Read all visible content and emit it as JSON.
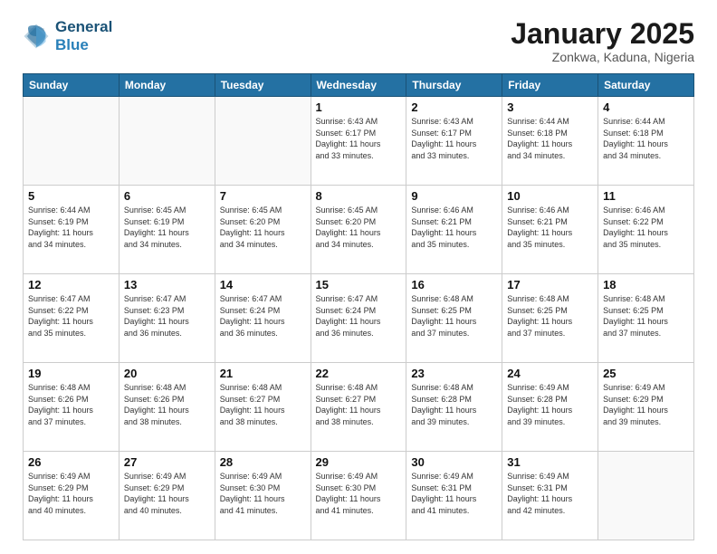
{
  "header": {
    "logo_line1": "General",
    "logo_line2": "Blue",
    "month_title": "January 2025",
    "subtitle": "Zonkwa, Kaduna, Nigeria"
  },
  "weekdays": [
    "Sunday",
    "Monday",
    "Tuesday",
    "Wednesday",
    "Thursday",
    "Friday",
    "Saturday"
  ],
  "weeks": [
    [
      {
        "day": "",
        "info": ""
      },
      {
        "day": "",
        "info": ""
      },
      {
        "day": "",
        "info": ""
      },
      {
        "day": "1",
        "info": "Sunrise: 6:43 AM\nSunset: 6:17 PM\nDaylight: 11 hours\nand 33 minutes."
      },
      {
        "day": "2",
        "info": "Sunrise: 6:43 AM\nSunset: 6:17 PM\nDaylight: 11 hours\nand 33 minutes."
      },
      {
        "day": "3",
        "info": "Sunrise: 6:44 AM\nSunset: 6:18 PM\nDaylight: 11 hours\nand 34 minutes."
      },
      {
        "day": "4",
        "info": "Sunrise: 6:44 AM\nSunset: 6:18 PM\nDaylight: 11 hours\nand 34 minutes."
      }
    ],
    [
      {
        "day": "5",
        "info": "Sunrise: 6:44 AM\nSunset: 6:19 PM\nDaylight: 11 hours\nand 34 minutes."
      },
      {
        "day": "6",
        "info": "Sunrise: 6:45 AM\nSunset: 6:19 PM\nDaylight: 11 hours\nand 34 minutes."
      },
      {
        "day": "7",
        "info": "Sunrise: 6:45 AM\nSunset: 6:20 PM\nDaylight: 11 hours\nand 34 minutes."
      },
      {
        "day": "8",
        "info": "Sunrise: 6:45 AM\nSunset: 6:20 PM\nDaylight: 11 hours\nand 34 minutes."
      },
      {
        "day": "9",
        "info": "Sunrise: 6:46 AM\nSunset: 6:21 PM\nDaylight: 11 hours\nand 35 minutes."
      },
      {
        "day": "10",
        "info": "Sunrise: 6:46 AM\nSunset: 6:21 PM\nDaylight: 11 hours\nand 35 minutes."
      },
      {
        "day": "11",
        "info": "Sunrise: 6:46 AM\nSunset: 6:22 PM\nDaylight: 11 hours\nand 35 minutes."
      }
    ],
    [
      {
        "day": "12",
        "info": "Sunrise: 6:47 AM\nSunset: 6:22 PM\nDaylight: 11 hours\nand 35 minutes."
      },
      {
        "day": "13",
        "info": "Sunrise: 6:47 AM\nSunset: 6:23 PM\nDaylight: 11 hours\nand 36 minutes."
      },
      {
        "day": "14",
        "info": "Sunrise: 6:47 AM\nSunset: 6:24 PM\nDaylight: 11 hours\nand 36 minutes."
      },
      {
        "day": "15",
        "info": "Sunrise: 6:47 AM\nSunset: 6:24 PM\nDaylight: 11 hours\nand 36 minutes."
      },
      {
        "day": "16",
        "info": "Sunrise: 6:48 AM\nSunset: 6:25 PM\nDaylight: 11 hours\nand 37 minutes."
      },
      {
        "day": "17",
        "info": "Sunrise: 6:48 AM\nSunset: 6:25 PM\nDaylight: 11 hours\nand 37 minutes."
      },
      {
        "day": "18",
        "info": "Sunrise: 6:48 AM\nSunset: 6:25 PM\nDaylight: 11 hours\nand 37 minutes."
      }
    ],
    [
      {
        "day": "19",
        "info": "Sunrise: 6:48 AM\nSunset: 6:26 PM\nDaylight: 11 hours\nand 37 minutes."
      },
      {
        "day": "20",
        "info": "Sunrise: 6:48 AM\nSunset: 6:26 PM\nDaylight: 11 hours\nand 38 minutes."
      },
      {
        "day": "21",
        "info": "Sunrise: 6:48 AM\nSunset: 6:27 PM\nDaylight: 11 hours\nand 38 minutes."
      },
      {
        "day": "22",
        "info": "Sunrise: 6:48 AM\nSunset: 6:27 PM\nDaylight: 11 hours\nand 38 minutes."
      },
      {
        "day": "23",
        "info": "Sunrise: 6:48 AM\nSunset: 6:28 PM\nDaylight: 11 hours\nand 39 minutes."
      },
      {
        "day": "24",
        "info": "Sunrise: 6:49 AM\nSunset: 6:28 PM\nDaylight: 11 hours\nand 39 minutes."
      },
      {
        "day": "25",
        "info": "Sunrise: 6:49 AM\nSunset: 6:29 PM\nDaylight: 11 hours\nand 39 minutes."
      }
    ],
    [
      {
        "day": "26",
        "info": "Sunrise: 6:49 AM\nSunset: 6:29 PM\nDaylight: 11 hours\nand 40 minutes."
      },
      {
        "day": "27",
        "info": "Sunrise: 6:49 AM\nSunset: 6:29 PM\nDaylight: 11 hours\nand 40 minutes."
      },
      {
        "day": "28",
        "info": "Sunrise: 6:49 AM\nSunset: 6:30 PM\nDaylight: 11 hours\nand 41 minutes."
      },
      {
        "day": "29",
        "info": "Sunrise: 6:49 AM\nSunset: 6:30 PM\nDaylight: 11 hours\nand 41 minutes."
      },
      {
        "day": "30",
        "info": "Sunrise: 6:49 AM\nSunset: 6:31 PM\nDaylight: 11 hours\nand 41 minutes."
      },
      {
        "day": "31",
        "info": "Sunrise: 6:49 AM\nSunset: 6:31 PM\nDaylight: 11 hours\nand 42 minutes."
      },
      {
        "day": "",
        "info": ""
      }
    ]
  ]
}
